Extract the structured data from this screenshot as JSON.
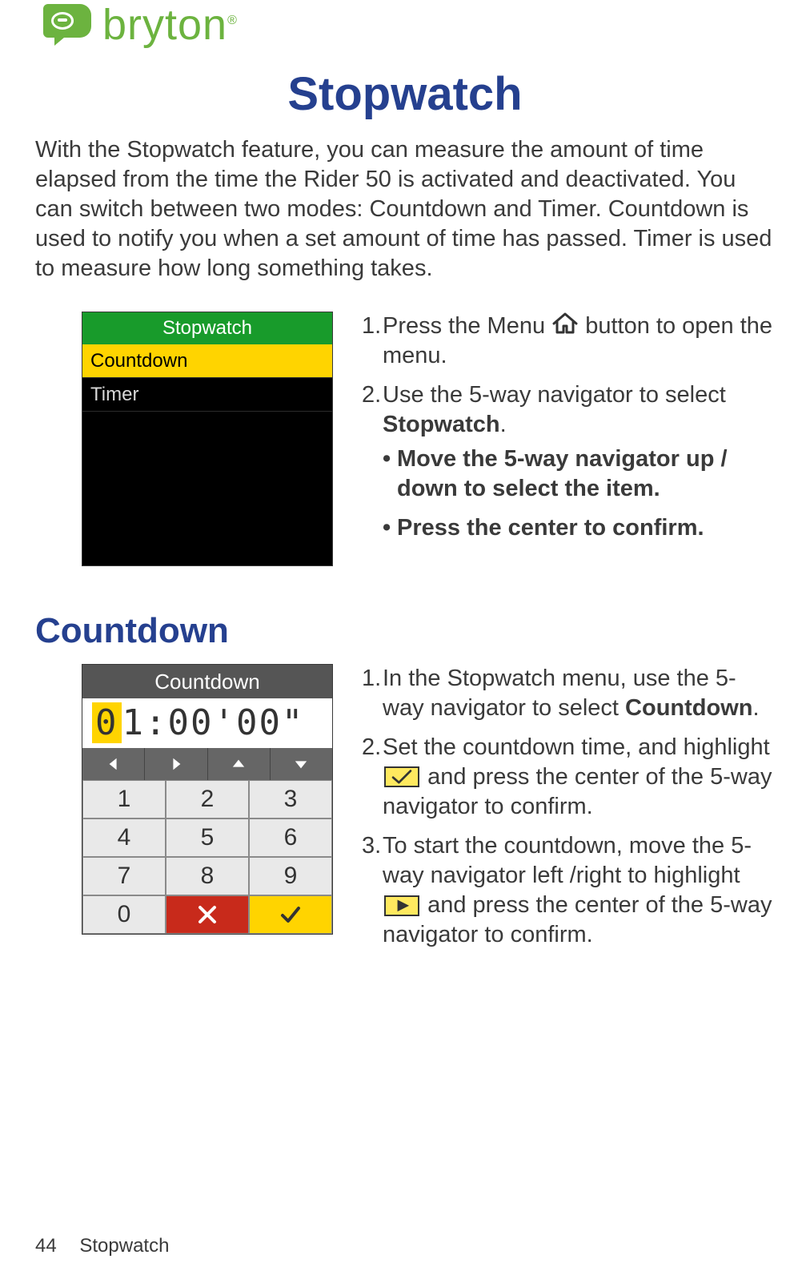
{
  "brand": {
    "word": "bryton",
    "reg": "®"
  },
  "h1": "Stopwatch",
  "intro": "With the Stopwatch feature, you can measure the amount of time elapsed from the time the Rider 50 is activated and deactivated. You can switch between two modes: Countdown and Timer. Countdown is used to notify you when a set amount of time has passed. Timer is used to measure how long something takes.",
  "stopwatch_menu": {
    "title": "Stopwatch",
    "items": [
      "Countdown",
      "Timer"
    ],
    "selected_index": 0
  },
  "steps_a": {
    "s1a": "Press the Menu ",
    "s1b": " button to open the menu.",
    "s2a": "Use the 5-way navigator to select ",
    "s2b": "Stopwatch",
    "s2c": ".",
    "sub1": "Move the 5-way navigator up / down to select the item.",
    "sub2": "Press the center to confirm."
  },
  "h2": "Countdown",
  "countdown_screen": {
    "title": "Countdown",
    "cursor_digit": "0",
    "rest": "1:00'00\"",
    "keys": [
      "1",
      "2",
      "3",
      "4",
      "5",
      "6",
      "7",
      "8",
      "9",
      "0"
    ]
  },
  "steps_b": {
    "s1a": "In the Stopwatch menu, use the 5-way navigator to select ",
    "s1b": "Countdown",
    "s1c": ".",
    "s2a": "Set the countdown time, and highlight  ",
    "s2b": " and press the center of the 5-way navigator to confirm.",
    "s3a": "To start the countdown, move the 5-way navigator left /right to highlight ",
    "s3b": " and press the center of the 5-way navigator to confirm."
  },
  "footer": {
    "page_number": "44",
    "section": "Stopwatch"
  }
}
